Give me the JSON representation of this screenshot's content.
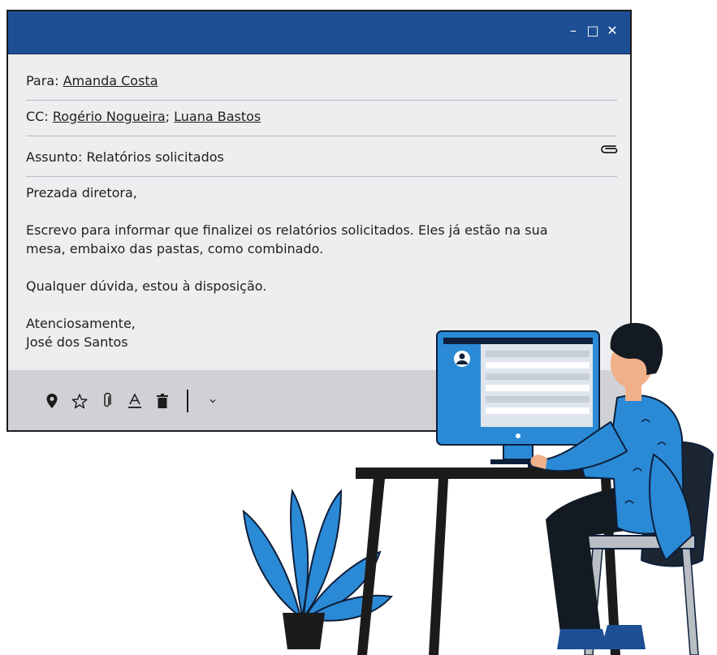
{
  "window": {
    "controls": {
      "minimize": "–",
      "maximize": "□",
      "close": "✕"
    }
  },
  "email": {
    "to_label": "Para:",
    "to": "Amanda Costa",
    "cc_label": "CC:",
    "cc": [
      "Rogério Nogueira",
      "Luana Bastos"
    ],
    "cc_separator": ";",
    "subject_label": "Assunto:",
    "subject": "Relatórios solicitados",
    "body": {
      "greeting": "Prezada diretora,",
      "paragraph1_line1": "Escrevo para informar que finalizei os relatórios solicitados. Eles já estão na sua",
      "paragraph1_line2": "mesa, embaixo das pastas, como combinado.",
      "paragraph2": "Qualquer dúvida, estou à disposição.",
      "closing": "Atenciosamente,",
      "signature": "José dos Santos"
    }
  },
  "toolbar": {
    "icons": [
      "location-pin-icon",
      "star-icon",
      "paperclip-icon",
      "text-color-icon",
      "trash-icon",
      "chevron-down-icon"
    ]
  },
  "colors": {
    "titlebar": "#1d4f95",
    "window_bg": "#eceef0",
    "toolbar_bg": "#cfd1d4",
    "accent_blue": "#2b8ad6"
  }
}
